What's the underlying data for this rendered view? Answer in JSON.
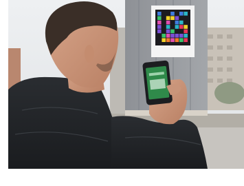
{
  "photo": {
    "subject": "man-scanning-code-with-phone",
    "code_colors": [
      "#e8365b",
      "#f2d22a",
      "#2bb6c8",
      "#7b4fd6",
      "#3f7de0",
      "#38c26a",
      "#f07a2a",
      "#e04fb0"
    ],
    "phone_screen_color": "#2f8a4a"
  }
}
